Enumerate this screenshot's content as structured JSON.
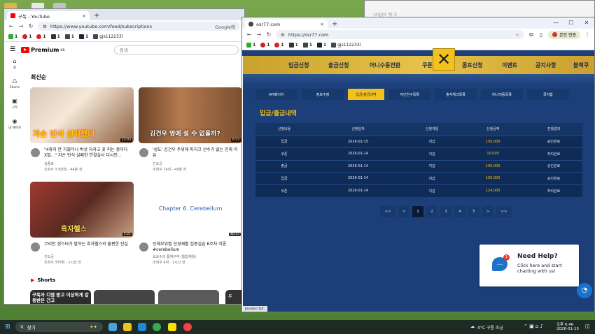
{
  "youtube": {
    "tab_title": "구독 - YouTube",
    "url": "https://www.youtube.com/feed/subscriptions",
    "url_suffix": "Google에",
    "logo": "Premium",
    "logo_sup": "KR",
    "search_placeholder": "검색",
    "section": "최신순",
    "sidebar": [
      "홈",
      "Shorts",
      "구독",
      "내 페이지"
    ],
    "bookmarks": [
      "1",
      "1",
      "1",
      "1",
      "1",
      "1",
      "gjs112233l"
    ],
    "videos": [
      {
        "title": "\"4휴지 안 치웠더니 버섯 자라고 꽃 피는 중이다 X발...\" 자손 번식 실패한 연결실사 디시인...",
        "channel": "김종호",
        "meta": "조회수 3.9만회 · 44분 전",
        "duration": "12:03",
        "overlay": "자손 번식 실패했다"
      },
      {
        "title": "'성도' 김건우 주위에 피지크 선수가 없는 진짜 이유",
        "channel": "간오공",
        "meta": "조회수 74회 · 45분 전",
        "duration": "6:53",
        "overlay": "김건우 옆에 설 수 없을까?"
      },
      {
        "title": "코리안 갱스터가 말하는 흑자헬스의 불편한 진실",
        "channel": "간오공",
        "meta": "조회수 378회 · 1시간 전",
        "duration": "5:21",
        "overlay": "흑자헬스"
      },
      {
        "title": "신체부위별 신경재활 집중실습 6주차 이론 #cerebellum",
        "channel": "요요수의 통재구역 (통합재활)",
        "meta": "조회수 4회 · 1시간 전",
        "duration": "40:37",
        "overlay": "Chapter 6. Cerebellum"
      }
    ],
    "shorts_label": "Shorts",
    "shorts": [
      "구독자 디엠 받고 이상하게 감동받은 간고",
      "두"
    ]
  },
  "site": {
    "tab_title": "osr77.com",
    "url": "https://osr77.com",
    "profile_btn": "본인 인증",
    "bookmarks": [
      "1",
      "1",
      "1",
      "1",
      "1",
      "1",
      "gjs112233l"
    ],
    "nav": [
      "입금신청",
      "출금신청",
      "머니수동전환",
      "쿠폰",
      "콤프신청",
      "이벤트",
      "공지사항",
      "블랙쿠"
    ],
    "subtabs": [
      "MY페이지",
      "정보수정",
      "입금/출금내역",
      "지인친구목록",
      "출석체크목록",
      "머니이동목록",
      "쪽지함"
    ],
    "page_title": "입금/출금내역",
    "table_headers": [
      "신청내용",
      "신청일자",
      "신청게임",
      "신청금액",
      "진행결과"
    ],
    "rows": [
      [
        "입금",
        "2026-01-15",
        "지갑",
        "150,000",
        "승인완료"
      ],
      [
        "쿠폰",
        "2026-01-14",
        "지갑",
        "10,000",
        "처리완료"
      ],
      [
        "출금",
        "2026-01-14",
        "지갑",
        "100,000",
        "승인완료"
      ],
      [
        "입금",
        "2026-01-14",
        "지갑",
        "100,000",
        "승인완료"
      ],
      [
        "쿠폰",
        "2026-01-14",
        "지갑",
        "124,000",
        "처리완료"
      ]
    ],
    "pager": [
      "<<",
      "<",
      "1",
      "2",
      "3",
      "4",
      "5",
      ">",
      ">>"
    ],
    "current_page": "1",
    "help_title": "Need Help?",
    "help_text": "Click here and start chatting with us!",
    "help_badge": "1",
    "status_bar": "javascript:"
  },
  "behind_window": {
    "text": "낸일만 친구"
  },
  "taskbar": {
    "search": "찾기",
    "weather": "4°C 구름 조금",
    "time": "오후 6:46",
    "date": "2026-01-15"
  },
  "colors": {
    "site_bg": "#1c3f7a",
    "gold": "#f2c21c",
    "yt_red": "#ff0000"
  }
}
